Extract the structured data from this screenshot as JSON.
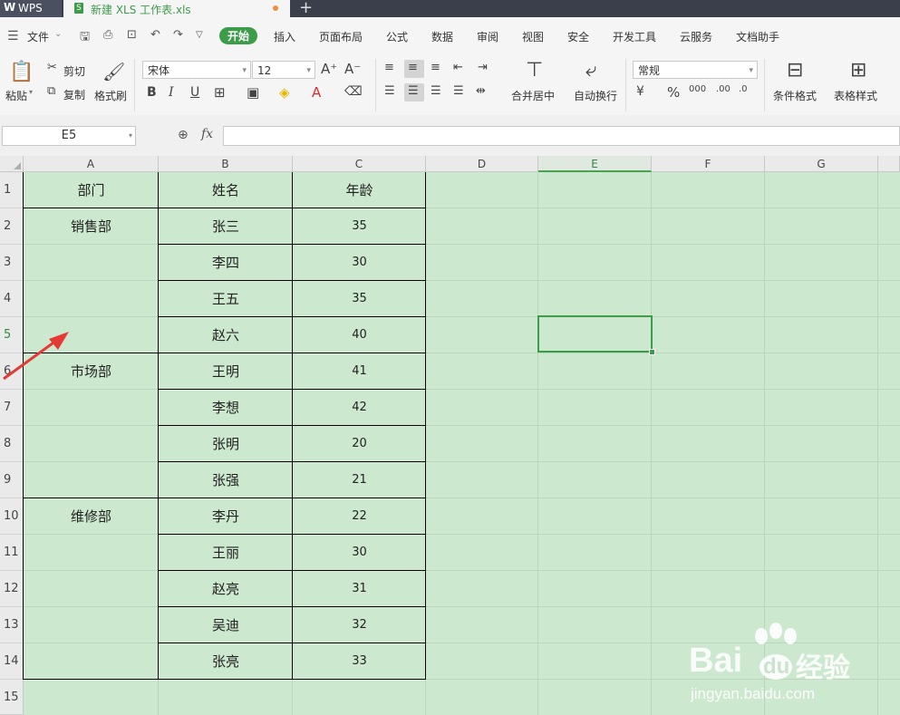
{
  "titlebar": {
    "app_tab": "WPS",
    "doc_tab": "新建 XLS 工作表.xls",
    "new_tab": "+"
  },
  "menubar": {
    "file": "文件",
    "items": [
      "开始",
      "插入",
      "页面布局",
      "公式",
      "数据",
      "审阅",
      "视图",
      "安全",
      "开发工具",
      "云服务",
      "文档助手"
    ],
    "active": "开始"
  },
  "ribbon": {
    "paste": "粘贴",
    "cut": "剪切",
    "copy": "复制",
    "format_painter": "格式刷",
    "font_name": "宋体",
    "font_size": "12",
    "merge_center": "合并居中",
    "wrap_text": "自动换行",
    "number_format": "常规",
    "conditional_format": "条件格式",
    "table_style": "表格样式"
  },
  "formula": {
    "name_box": "E5",
    "fx": "fx",
    "value": ""
  },
  "sheet": {
    "columns": [
      "A",
      "B",
      "C",
      "D",
      "E",
      "F",
      "G"
    ],
    "rows": [
      "1",
      "2",
      "3",
      "4",
      "5",
      "6",
      "7",
      "8",
      "9",
      "10",
      "11",
      "12",
      "13",
      "14",
      "15"
    ],
    "active_cell": "E5",
    "cells": {
      "A1": "部门",
      "B1": "姓名",
      "C1": "年龄",
      "A2": "销售部",
      "B2": "张三",
      "C2": "35",
      "B3": "李四",
      "C3": "30",
      "B4": "王五",
      "C4": "35",
      "B5": "赵六",
      "C5": "40",
      "A6": "市场部",
      "B6": "王明",
      "C6": "41",
      "B7": "李想",
      "C7": "42",
      "B8": "张明",
      "C8": "20",
      "B9": "张强",
      "C9": "21",
      "A10": "维修部",
      "B10": "李丹",
      "C10": "22",
      "B11": "王丽",
      "C11": "30",
      "B12": "赵亮",
      "C12": "31",
      "B13": "吴迪",
      "C13": "32",
      "B14": "张亮",
      "C14": "33"
    }
  },
  "watermark": {
    "brand": "Bai",
    "brand2": "du",
    "cn": "经验",
    "url": "jingyan.baidu.com"
  }
}
